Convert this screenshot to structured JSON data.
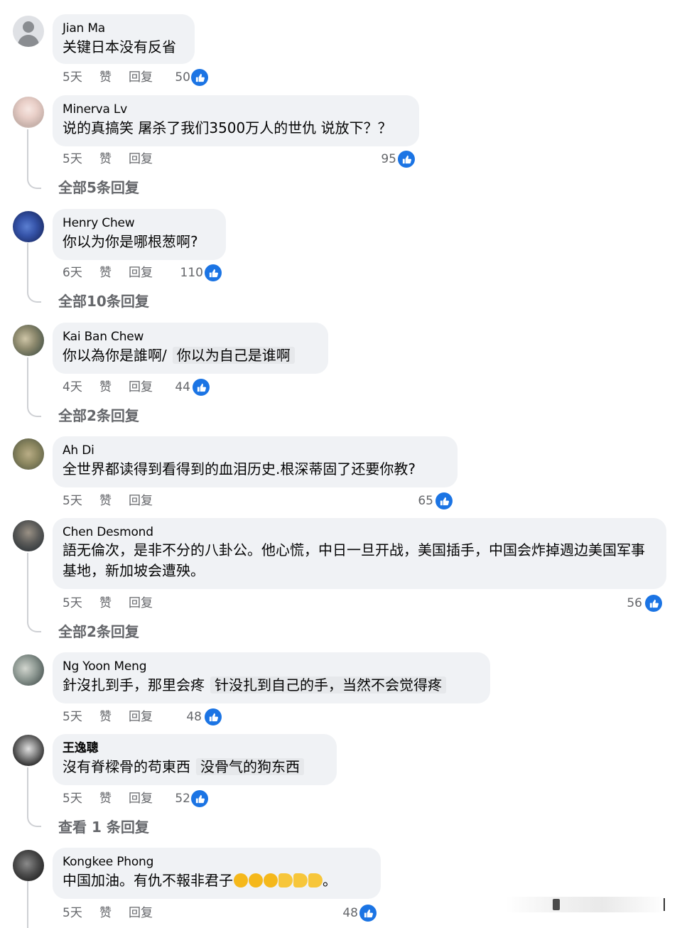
{
  "accent_color": "#1b74e4",
  "like_label": "赞",
  "reply_label": "回复",
  "comments": [
    {
      "name": "Jian Ma",
      "text": "关键日本没有反省",
      "time": "5天",
      "likes": "50",
      "avatar": "default-avatar-icon"
    },
    {
      "name": "Minerva Lv",
      "text": "说的真搞笑 屠杀了我们3500万人的世仇 说放下？？",
      "time": "5天",
      "likes": "95",
      "view_replies": "全部5条回复"
    },
    {
      "name": "Henry Chew",
      "text": "你以为你是哪根葱啊?",
      "time": "6天",
      "likes": "110",
      "view_replies": "全部10条回复"
    },
    {
      "name": "Kai Ban Chew",
      "text": "你以為你是誰啊/",
      "translation": "你以为自己是谁啊",
      "time": "4天",
      "likes": "44",
      "view_replies": "全部2条回复"
    },
    {
      "name": "Ah Di",
      "text": "全世界都读得到看得到的血泪历史.根深蒂固了还要你教?",
      "time": "5天",
      "likes": "65"
    },
    {
      "name": "Chen Desmond",
      "text": "語无倫次，是非不分的八卦公。他心慌，中日一旦开战，美国插手，中国会炸掉週边美国军事基地，新加坡会遭殃。",
      "time": "5天",
      "likes": "56",
      "view_replies": "全部2条回复"
    },
    {
      "name": "Ng Yoon Meng",
      "text": "針沒扎到手，那里会疼",
      "translation": "针没扎到自己的手，当然不会觉得疼",
      "time": "5天",
      "likes": "48"
    },
    {
      "name": "王逸聰",
      "text": "沒有脊樑骨的苟東西",
      "translation": "没骨气的狗东西",
      "time": "5天",
      "likes": "52",
      "view_replies": "查看 1 条回复"
    },
    {
      "name": "Kongkee Phong",
      "text": "中国加油。有仇不報非君子",
      "text_tail": "。",
      "time": "5天",
      "likes": "48",
      "emoji": [
        "clap-emoji-icon",
        "clap-emoji-icon",
        "clap-emoji-icon",
        "flexed-biceps-emoji-icon",
        "flexed-biceps-emoji-icon",
        "flexed-biceps-emoji-icon"
      ]
    }
  ]
}
